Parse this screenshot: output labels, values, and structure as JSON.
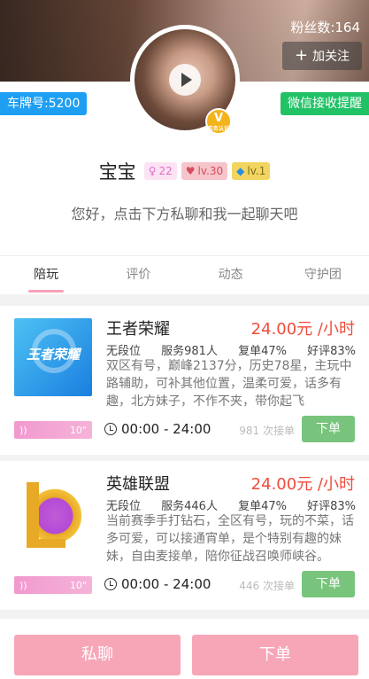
{
  "header": {
    "fans_text": "粉丝数:164",
    "follow_label": "加关注",
    "plate_tag": "车牌号:5200",
    "wechat_tag": "微信接收提醒"
  },
  "profile": {
    "name": "宝宝",
    "gender_count": "22",
    "heart_level": "lv.30",
    "diamond_level": "lv.1",
    "vip_badge": "V",
    "vip_badge_sub": "实名认证",
    "slogan": "您好，点击下方私聊和我一起聊天吧"
  },
  "tabs": [
    {
      "label": "陪玩"
    },
    {
      "label": "评价"
    },
    {
      "label": "动态"
    },
    {
      "label": "守护团"
    }
  ],
  "games": [
    {
      "title": "王者荣耀",
      "thumb_text": "王者荣耀",
      "price": "24.00元 /小时",
      "rank": "无段位",
      "served": "服务981人",
      "repeat": "复单47%",
      "praise": "好评83%",
      "description": "双区有号，巅峰2137分，历史78星，主玩中路辅助，可补其他位置，温柔可爱，话多有趣，北方妹子，不作不夹，带你起飞",
      "voice_duration": "10\"",
      "time": "00:00 - 24:00",
      "orders": "981 次接单",
      "order_button": "下单"
    },
    {
      "title": "英雄联盟",
      "price": "24.00元 /小时",
      "rank": "无段位",
      "served": "服务446人",
      "repeat": "复单47%",
      "praise": "好评83%",
      "description": "当前赛季手打钻石，全区有号，玩的不菜，话多可爱，可以接通宵单，是个特别有趣的妹妹，自由麦接单，陪你征战召唤师峡谷。",
      "voice_duration": "10\"",
      "time": "00:00 - 24:00",
      "orders": "446 次接单",
      "order_button": "下单"
    }
  ],
  "bottom_bar": {
    "chat_label": "私聊",
    "order_label": "下单"
  }
}
